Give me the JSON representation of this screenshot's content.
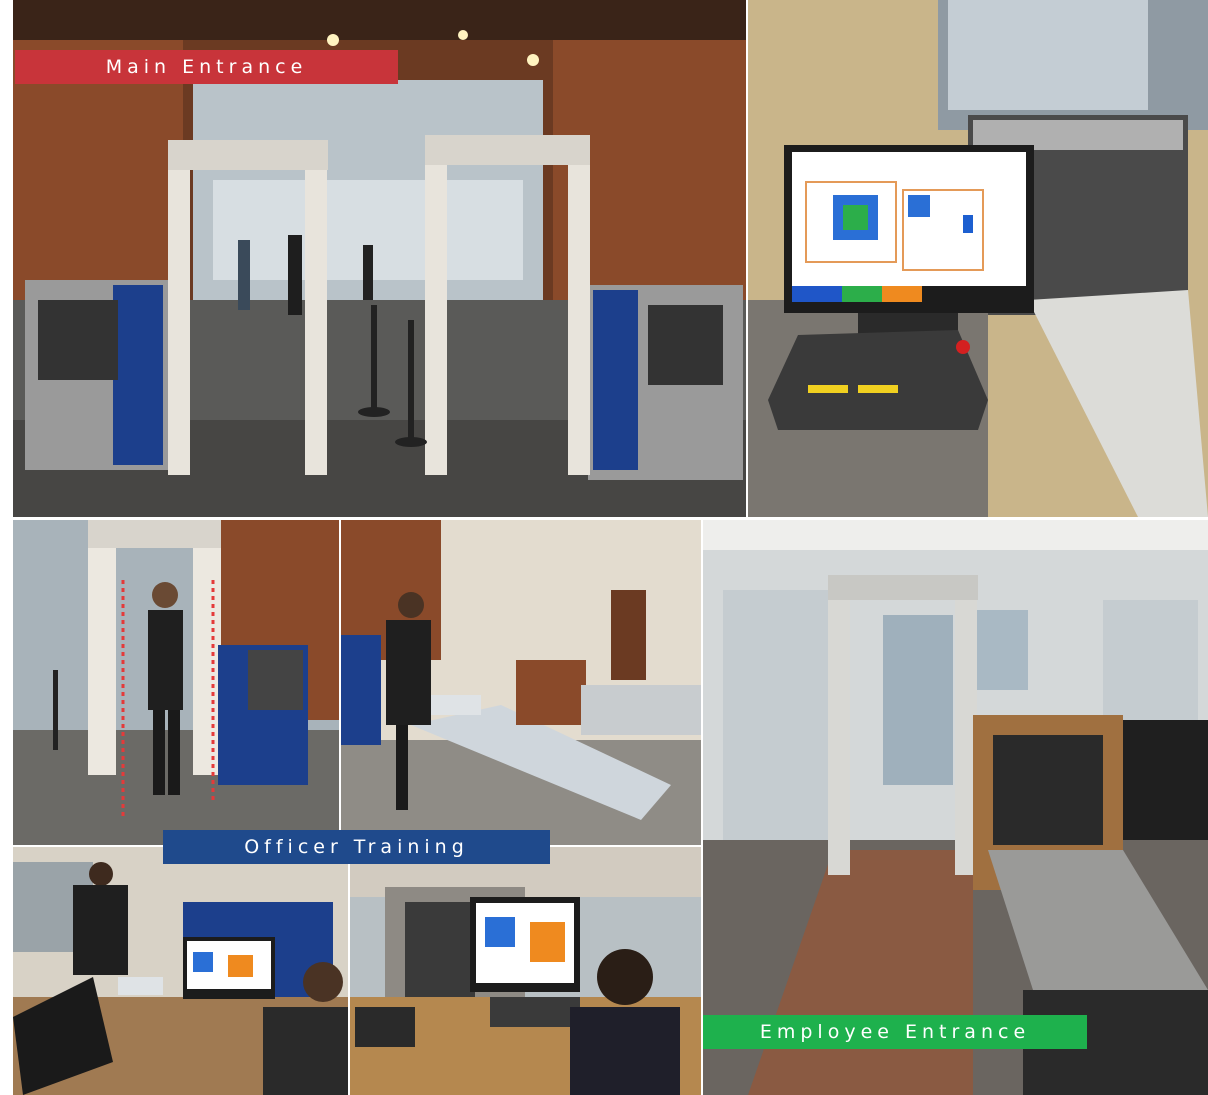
{
  "captions": {
    "main_entrance": "Main Entrance",
    "officer_training": "Officer Training",
    "employee_entrance": "Employee Entrance"
  },
  "colors": {
    "main_entrance_bar": "#c8343a",
    "officer_training_bar": "#1f4a8c",
    "employee_entrance_bar": "#1eb14d"
  }
}
